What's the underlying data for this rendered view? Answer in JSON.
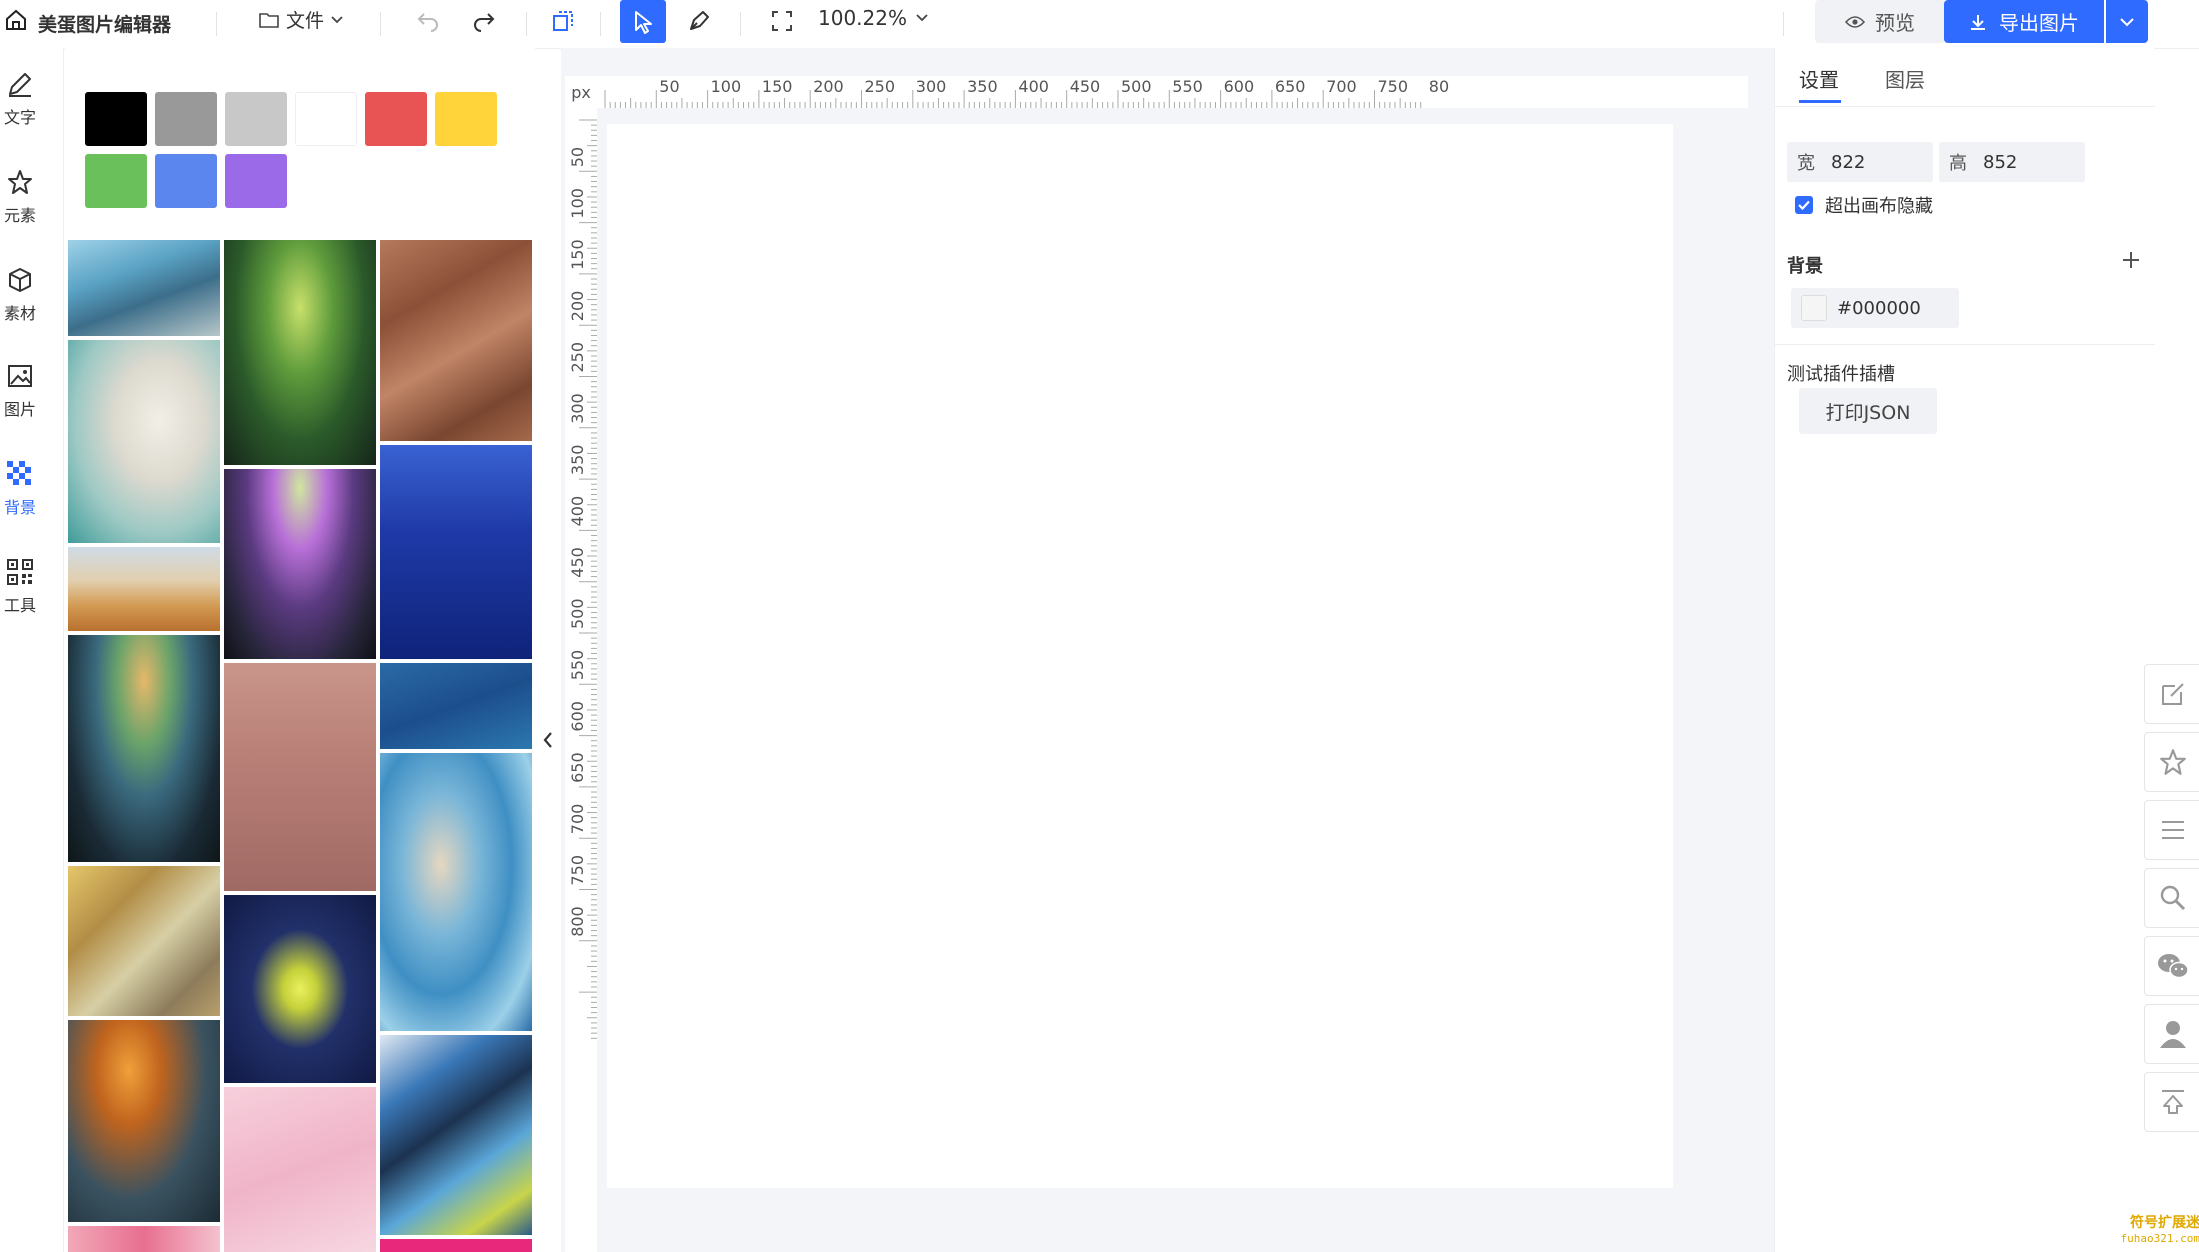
{
  "app": {
    "title": "美蛋图片编辑器"
  },
  "toolbar": {
    "file_label": "文件",
    "zoom_label": "100.22%",
    "preview_label": "预览",
    "export_label": "导出图片"
  },
  "leftnav": {
    "items": [
      {
        "label": "文字",
        "icon": "pen-icon"
      },
      {
        "label": "元素",
        "icon": "star-icon"
      },
      {
        "label": "素材",
        "icon": "cube-icon"
      },
      {
        "label": "图片",
        "icon": "image-icon"
      },
      {
        "label": "背景",
        "icon": "checker-icon",
        "active": true
      },
      {
        "label": "工具",
        "icon": "qr-icon"
      }
    ]
  },
  "swatches": [
    "#000000",
    "#999999",
    "#c8c8c8",
    "#ffffff",
    "#e85454",
    "#ffd43b",
    "#6ac15c",
    "#5b86ee",
    "#9a6ae8"
  ],
  "ruler": {
    "unit": "px",
    "top_ticks": [
      "50",
      "100",
      "150",
      "200",
      "250",
      "300",
      "350",
      "400",
      "450",
      "500",
      "550",
      "600",
      "650",
      "700",
      "750",
      "80"
    ],
    "left_ticks": [
      "50",
      "100",
      "150",
      "200",
      "250",
      "300",
      "350",
      "400",
      "450",
      "500",
      "550",
      "600",
      "650",
      "700",
      "750",
      "800"
    ]
  },
  "settings": {
    "tabs": [
      {
        "label": "设置",
        "active": true
      },
      {
        "label": "图层",
        "active": false
      }
    ],
    "width_label": "宽",
    "width_value": "822",
    "height_label": "高",
    "height_value": "852",
    "clip_label": "超出画布隐藏",
    "clip_checked": true,
    "background_title": "背景",
    "background_value": "#000000",
    "plugin_title": "测试插件插槽",
    "print_json_label": "打印JSON"
  },
  "watermark": {
    "line1": "符号扩展迷",
    "line2": "fuhao321.com"
  },
  "colors": {
    "accent": "#2f6bff",
    "canvas_bg": "#f3f5f8"
  }
}
